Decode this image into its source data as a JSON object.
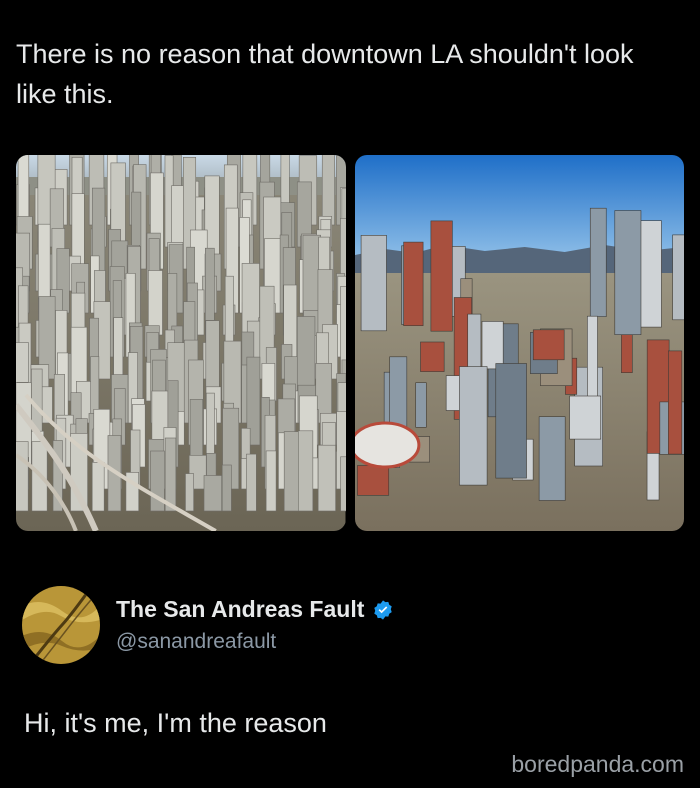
{
  "post": {
    "text": "There is no reason that downtown LA shouldn't look like this."
  },
  "images": {
    "left_alt_icon": "dense-skyscraper-city-image",
    "right_alt_icon": "downtown-la-aerial-image"
  },
  "reply": {
    "display_name": "The San Andreas Fault",
    "handle": "@sanandreafault",
    "text": "Hi, it's me, I'm the reason"
  },
  "watermark": "boredpanda.com",
  "colors": {
    "background": "#000000",
    "text": "#e7e9ea",
    "muted": "#8b98a5",
    "verified_blue": "#1d9bf0"
  }
}
